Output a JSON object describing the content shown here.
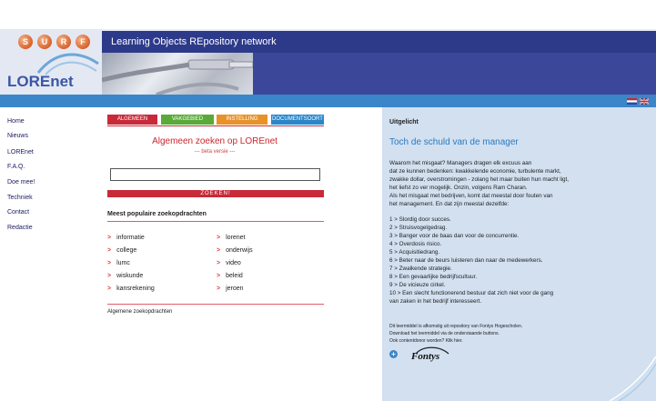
{
  "header": {
    "logo_letters": [
      "S",
      "U",
      "R",
      "F"
    ],
    "logo_word": "LOREnet",
    "title": "Learning Objects REpository network",
    "languages": [
      "nl-flag-icon",
      "uk-flag-icon"
    ]
  },
  "nav": {
    "items": [
      {
        "label": "Home"
      },
      {
        "label": "Nieuws"
      },
      {
        "label": "LOREnet"
      },
      {
        "label": "F.A.Q."
      },
      {
        "label": "Doe mee!"
      },
      {
        "label": "Techniek"
      },
      {
        "label": "Contact"
      },
      {
        "label": "Redactie"
      }
    ]
  },
  "search": {
    "tabs": [
      {
        "label": "ALGEMEEN",
        "color": "#c82a3a"
      },
      {
        "label": "VAKGEBIED",
        "color": "#5aaa3a"
      },
      {
        "label": "INSTELLING",
        "color": "#e8922a"
      },
      {
        "label": "DOCUMENTSOORT",
        "color": "#2a86c8"
      }
    ],
    "title": "Algemeen zoeken op LOREnet",
    "beta": "--- beta versie ---",
    "input_value": "",
    "button_label": "ZOEKEN!",
    "popular_title": "Meest populaire zoekopdrachten",
    "popular_left": [
      "informatie",
      "college",
      "lumc",
      "wiskunde",
      "kansrekening"
    ],
    "popular_right": [
      "lorenet",
      "onderwijs",
      "video",
      "beleid",
      "jeroen"
    ],
    "arrow": ">",
    "general_link": "Algemene zoekopdrachten"
  },
  "featured": {
    "label": "Uitgelicht",
    "title": "Toch de schuld van de manager",
    "paragraph": [
      "Waarom het misgaat? Managers dragen elk excuus aan",
      "dat ze kunnen bedenken: kwakkelende economie, turbulente markt,",
      "zwakke dollar, overstromingen - zolang het maar buiten hun macht ligt,",
      "het liefst zo ver mogelijk. Onzin, volgens Ram Charan.",
      "Als het misgaat met bedrijven, komt dat meestal door fouten van",
      "het management. En dat zijn meestal dezelfde:"
    ],
    "list": [
      "1 > Slordig door succes.",
      "2 > Struisvogelgedrag.",
      "3 > Banger voor de baas dan voor de concurrentie.",
      "4 > Overdosis risico.",
      "5 > Acquisitiedrang.",
      "6 > Beter naar de beurs luisteren dan naar de medewerkers.",
      "7 > Zwalkende strategie.",
      "8 > Een gevaarlijke bedrijfscultuur.",
      "9 > De vicieuze cirkel.",
      "10 > Een slecht functionerend bestuur dat zich niet voor de gang",
      "van zaken in het bedrijf interesseert."
    ],
    "footnote": [
      "Dit leermiddel is afkomstig uit repository van Fontys Hogescholen.",
      "Download het leermiddel via de onderstaande buttons.",
      "Ook contentdonor worden? Klik hier."
    ],
    "download_icon": "plus-circle-icon",
    "partner_logo": "Fontys"
  }
}
